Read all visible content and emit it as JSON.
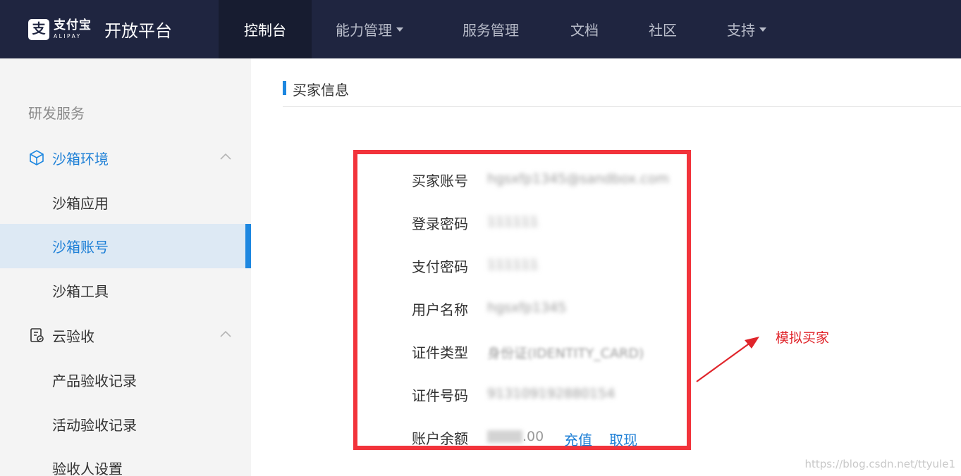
{
  "topbar": {
    "logo_cn": "支付宝",
    "logo_en": "ALIPAY",
    "platform_title": "开放平台",
    "nav": [
      {
        "label": "控制台",
        "active": true
      },
      {
        "label": "能力管理",
        "dropdown": true
      },
      {
        "label": "服务管理"
      },
      {
        "label": "文档"
      },
      {
        "label": "社区"
      },
      {
        "label": "支持",
        "dropdown": true
      }
    ]
  },
  "sidebar": {
    "section_title": "研发服务",
    "groups": [
      {
        "label": "沙箱环境",
        "icon": "cube-icon",
        "expanded": true,
        "items": [
          "沙箱应用",
          "沙箱账号",
          "沙箱工具"
        ],
        "active_item": "沙箱账号"
      },
      {
        "label": "云验收",
        "icon": "clipboard-icon",
        "expanded": true,
        "items": [
          "产品验收记录",
          "活动验收记录",
          "验收人设置"
        ]
      }
    ]
  },
  "content": {
    "section_title": "买家信息",
    "fields": [
      {
        "label": "买家账号",
        "value": "hgsxfp1345@sandbox.com"
      },
      {
        "label": "登录密码",
        "value": "111111"
      },
      {
        "label": "支付密码",
        "value": "111111"
      },
      {
        "label": "用户名称",
        "value": "hgsxfp1345"
      },
      {
        "label": "证件类型",
        "value": "身份证(IDENTITY_CARD)"
      },
      {
        "label": "证件号码",
        "value": "913109192880154"
      },
      {
        "label": "账户余额",
        "value_tail": ".00",
        "actions": [
          "充值",
          "取现"
        ]
      }
    ],
    "annotation": "模拟买家"
  },
  "watermark": "https://blog.csdn.net/ttyule1",
  "colors": {
    "topbar_bg": "#1f2540",
    "accent_blue": "#1d87e0",
    "highlight_red": "#f2333b",
    "sidebar_bg": "#f4f4f4"
  }
}
